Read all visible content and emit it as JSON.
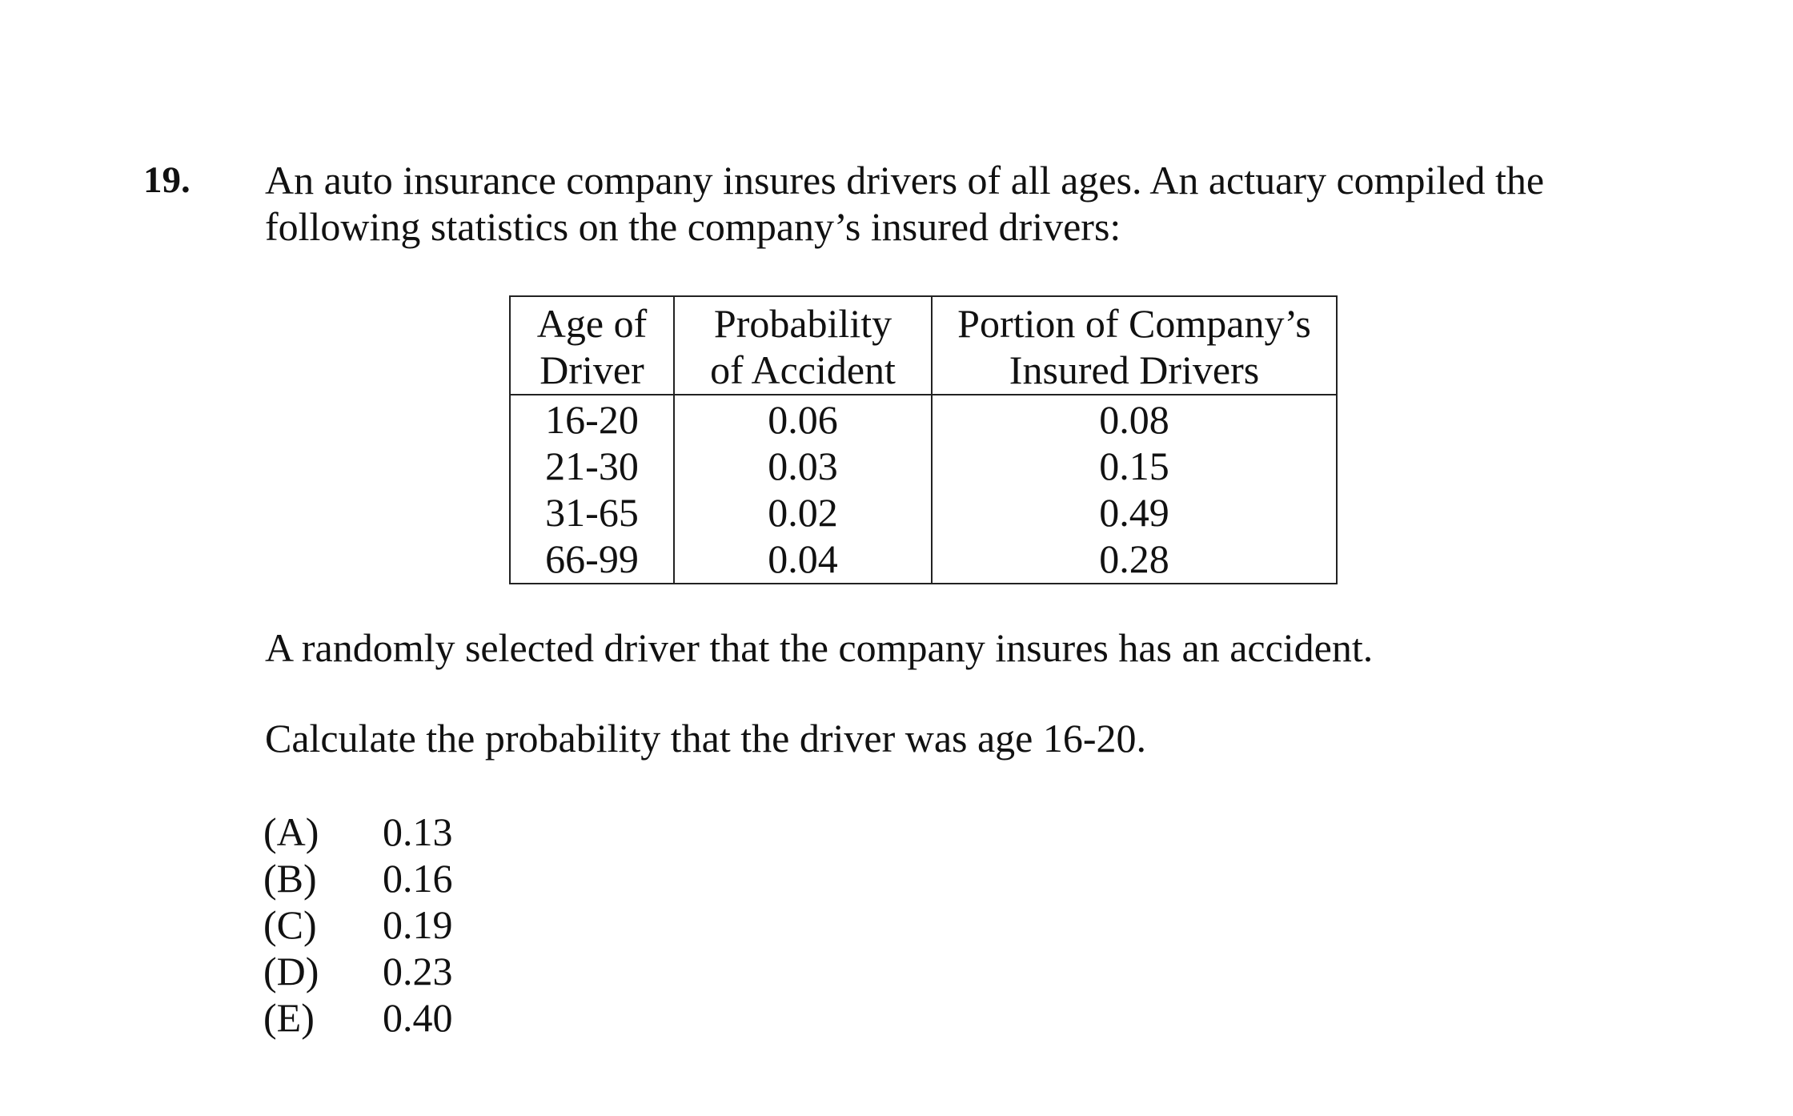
{
  "question": {
    "number": "19.",
    "intro_lines": [
      "An auto insurance company insures drivers of all ages.  An actuary compiled the",
      "following statistics on the company’s insured drivers:"
    ],
    "table": {
      "headers": [
        [
          "Age of",
          "Driver"
        ],
        [
          "Probability",
          "of Accident"
        ],
        [
          "Portion of Company’s",
          "Insured Drivers"
        ]
      ],
      "rows": [
        [
          "16-20",
          "0.06",
          "0.08"
        ],
        [
          "21-30",
          "0.03",
          "0.15"
        ],
        [
          "31-65",
          "0.02",
          "0.49"
        ],
        [
          "66-99",
          "0.04",
          "0.28"
        ]
      ]
    },
    "stem_1": "A randomly selected driver that the company insures has an accident.",
    "stem_2": "Calculate the probability that the driver was age 16-20.",
    "choices": [
      {
        "letter": "(A)",
        "value": "0.13"
      },
      {
        "letter": "(B)",
        "value": "0.16"
      },
      {
        "letter": "(C)",
        "value": "0.19"
      },
      {
        "letter": "(D)",
        "value": "0.23"
      },
      {
        "letter": "(E)",
        "value": "0.40"
      }
    ]
  }
}
